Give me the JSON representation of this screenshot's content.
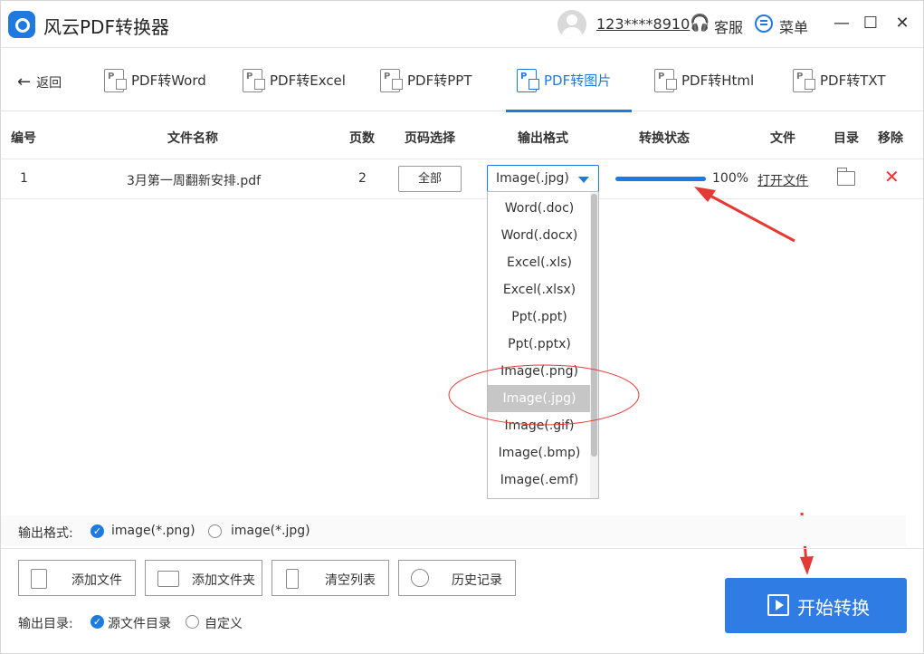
{
  "app": {
    "title": "风云PDF转换器"
  },
  "header": {
    "user_phone": "123****8910",
    "service_label": "客服",
    "menu_label": "菜单",
    "minimize": "—",
    "maximize": "☐",
    "close": "✕"
  },
  "nav": {
    "back_label": "返回",
    "tabs": [
      {
        "label": "PDF转Word",
        "icon": "pdf-word-icon"
      },
      {
        "label": "PDF转Excel",
        "icon": "pdf-excel-icon"
      },
      {
        "label": "PDF转PPT",
        "icon": "pdf-ppt-icon"
      },
      {
        "label": "PDF转图片",
        "icon": "pdf-image-icon",
        "active": true
      },
      {
        "label": "PDF转Html",
        "icon": "pdf-html-icon"
      },
      {
        "label": "PDF转TXT",
        "icon": "pdf-txt-icon"
      }
    ]
  },
  "table": {
    "headers": {
      "index": "编号",
      "name": "文件名称",
      "pages": "页数",
      "page_select": "页码选择",
      "format": "输出格式",
      "status": "转换状态",
      "file": "文件",
      "dir": "目录",
      "remove": "移除"
    },
    "rows": [
      {
        "index": "1",
        "name": "3月第一周翻新安排.pdf",
        "pages": "2",
        "page_select": "全部",
        "format": "Image(.jpg)",
        "progress": 1.0,
        "progress_text": "100%",
        "open_file": "打开文件"
      }
    ]
  },
  "dropdown": {
    "options": [
      "Word(.doc)",
      "Word(.docx)",
      "Excel(.xls)",
      "Excel(.xlsx)",
      "Ppt(.ppt)",
      "Ppt(.pptx)",
      "Image(.png)",
      "Image(.jpg)",
      "Image(.gif)",
      "Image(.bmp)",
      "Image(.emf)"
    ],
    "selected": "Image(.jpg)"
  },
  "output_format": {
    "label": "输出格式:",
    "options": [
      "image(*.png)",
      "image(*.jpg)"
    ],
    "selected": "image(*.png)"
  },
  "actions": {
    "add_file": "添加文件",
    "add_folder": "添加文件夹",
    "clear_list": "清空列表",
    "history": "历史记录"
  },
  "output_dir": {
    "label": "输出目录:",
    "source": "源文件目录",
    "custom": "自定义",
    "selected": "源文件目录"
  },
  "start_button": {
    "label": "开始转换"
  },
  "colors": {
    "accent": "#1f7ae0",
    "start_button": "#2f7ce4",
    "annotation": "#e53935"
  }
}
